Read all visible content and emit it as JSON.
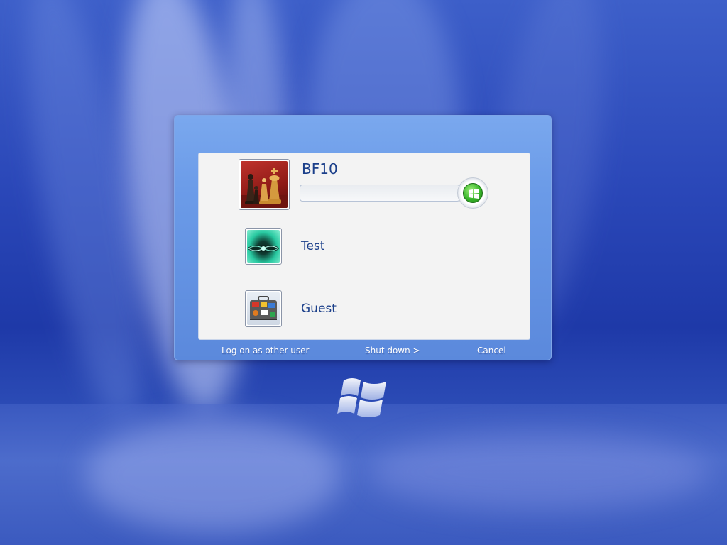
{
  "users": [
    {
      "name": "BF10",
      "avatar": "chess-pieces-picture",
      "selected": true
    },
    {
      "name": "Test",
      "avatar": "teal-abstract-picture",
      "selected": false
    },
    {
      "name": "Guest",
      "avatar": "suitcase-picture",
      "selected": false
    }
  ],
  "password": {
    "value": "",
    "placeholder": ""
  },
  "go_button": {
    "icon": "windows-flag-icon"
  },
  "links": {
    "other_user": "Log on as other user",
    "shut_down": "Shut down >",
    "cancel": "Cancel"
  },
  "colors": {
    "name_text": "#1b3f8a",
    "go_green": "#38b52a",
    "dialog_blue": "#6b9be8"
  },
  "desktop": {
    "logo": "windows-flag-logo"
  }
}
